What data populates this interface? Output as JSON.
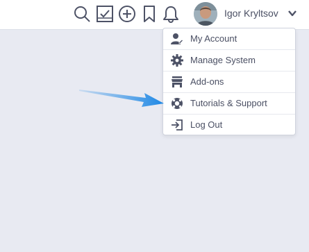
{
  "header": {
    "icons": [
      "search-icon",
      "tasks-icon",
      "add-icon",
      "bookmark-icon",
      "notifications-icon"
    ],
    "user": {
      "name": "Igor Kryltsov",
      "avatar": "avatar-photo"
    }
  },
  "user_menu": {
    "items": [
      {
        "label": "My Account",
        "icon": "user-edit-icon"
      },
      {
        "label": "Manage System",
        "icon": "gear-icon"
      },
      {
        "label": "Add-ons",
        "icon": "store-icon"
      },
      {
        "label": "Tutorials & Support",
        "icon": "life-ring-icon"
      },
      {
        "label": "Log Out",
        "icon": "logout-icon"
      }
    ]
  },
  "colors": {
    "accent": "#4a4f63",
    "icon": "#4d5266",
    "annotation_arrow": "#1e88e5",
    "background": "#e8eaf2"
  }
}
